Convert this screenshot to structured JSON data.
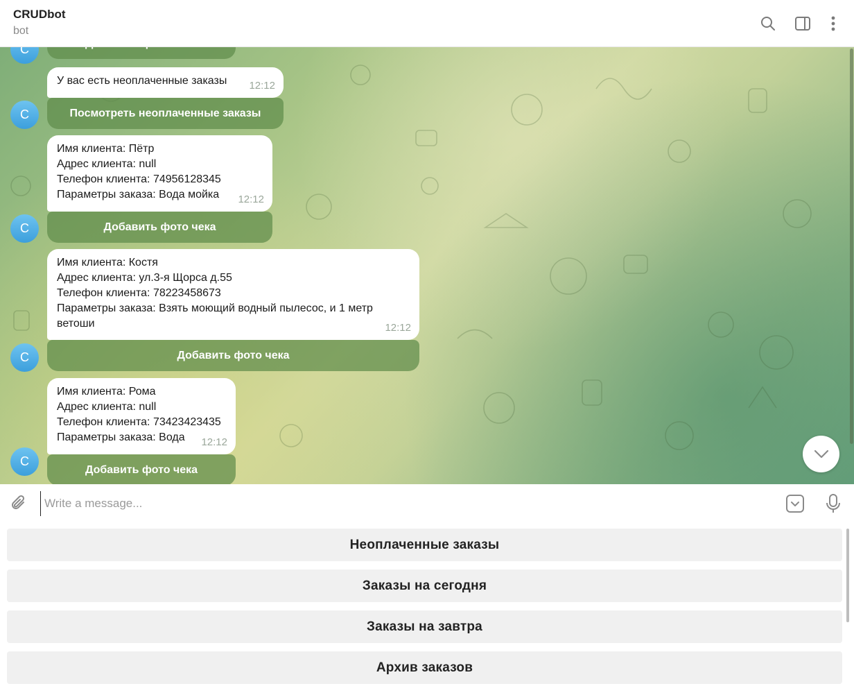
{
  "header": {
    "title": "CRUDbot",
    "subtitle": "bot"
  },
  "avatar_letter": "C",
  "messages": [
    {
      "lines": [
        "У вас есть неоплаченные заказы"
      ],
      "time": "12:12",
      "button": "Посмотреть неоплаченные заказы"
    },
    {
      "lines": [
        "Имя клиента: Пётр",
        "Адрес клиента: null",
        "Телефон клиента: 74956128345",
        "Параметры заказа: Вода мойка"
      ],
      "time": "12:12",
      "button": "Добавить фото чека"
    },
    {
      "lines": [
        "Имя клиента: Костя",
        "Адрес клиента: ул.3-я Щорса д.55",
        "Телефон клиента: 78223458673",
        "Параметры заказа: Взять моющий водный пылесос, и 1 метр",
        "ветоши"
      ],
      "time": "12:12",
      "button": "Добавить фото чека"
    },
    {
      "lines": [
        "Имя клиента: Рома",
        "Адрес клиента: null",
        "Телефон клиента: 73423423435",
        "Параметры заказа: Вода"
      ],
      "time": "12:12",
      "button": "Добавить фото чека"
    }
  ],
  "partial_top_button": "Добавить фото чека",
  "composer": {
    "placeholder": "Write a message..."
  },
  "keyboard": {
    "buttons": [
      "Неоплаченные заказы",
      "Заказы на сегодня",
      "Заказы на завтра",
      "Архив заказов"
    ]
  },
  "icons": {
    "search": "search-icon",
    "sidebar": "sidebar-toggle-icon",
    "more": "more-vertical-icon",
    "attach": "paperclip-icon",
    "commands": "bot-commands-icon",
    "mic": "microphone-icon",
    "scroll_down": "chevron-down-icon"
  },
  "colors": {
    "accent_avatar": "#3c9fdc",
    "inline_button": "#5f8c4b"
  }
}
